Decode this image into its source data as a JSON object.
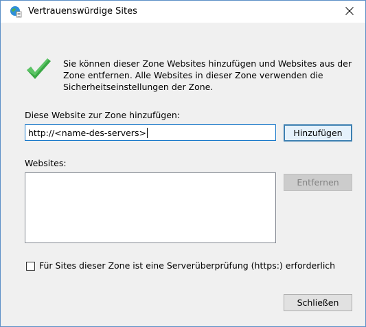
{
  "window": {
    "title": "Vertrauenswürdige Sites"
  },
  "info": {
    "text": "Sie können dieser Zone Websites hinzufügen und Websites aus der Zone entfernen. Alle Websites in dieser Zone verwenden die Sicherheitseinstellungen der Zone."
  },
  "add_section": {
    "label": "Diese Website zur Zone hinzufügen:",
    "input_value": "http://<name-des-servers>",
    "add_button": "Hinzufügen"
  },
  "websites": {
    "label": "Websites:",
    "items": [],
    "remove_button": "Entfernen"
  },
  "https_check": {
    "label": "Für Sites dieser Zone ist eine Serverüberprüfung (https:) erforderlich",
    "checked": false
  },
  "footer": {
    "close_button": "Schließen"
  },
  "colors": {
    "accent": "#1979ca",
    "check": "#3aa845"
  }
}
